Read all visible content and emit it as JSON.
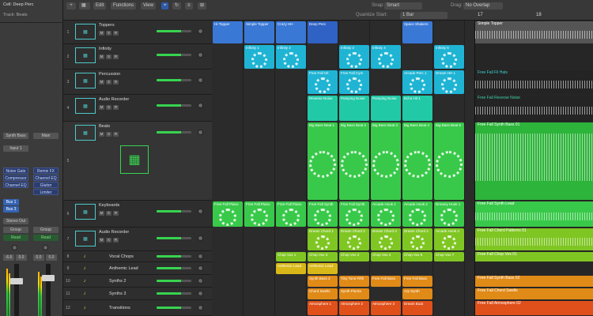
{
  "header": {
    "cell_label": "Cell: Deep Perc",
    "track_label": "Track: Beats",
    "edit_menu": "Edit",
    "functions_menu": "Functions",
    "view_menu": "View",
    "quantize_label": "Quantize Start:",
    "quantize_value": "1 Bar",
    "snap_label": "Snap:",
    "snap_value": "Smart",
    "drag_label": "Drag:",
    "drag_value": "No Overlap",
    "ruler": [
      "17",
      "18"
    ]
  },
  "inspector": {
    "strip1": {
      "setting": "Synth Bass",
      "input": "Input 1",
      "plugins": [
        "Noise Gate",
        "Compressor",
        "Channel EQ"
      ],
      "bus": "Bus 1",
      "bus2": "Bus 3",
      "output": "Stereo Out",
      "group": "Group",
      "read": "Read",
      "vol": "-6.6",
      "pan": "0.0"
    },
    "strip2": {
      "setting": "Main",
      "plugins": [
        "Remix FX",
        "Channel EQ",
        "Gluitor",
        "Limiter"
      ],
      "group": "Group",
      "read": "Read",
      "vol": "0.0",
      "pan": "0.0"
    }
  },
  "ms": {
    "m": "M",
    "s": "S",
    "r": "R"
  },
  "tracks": [
    {
      "num": "1",
      "name": "Toppers"
    },
    {
      "num": "2",
      "name": "Infinity"
    },
    {
      "num": "3",
      "name": "Percussion"
    },
    {
      "num": "4",
      "name": "Audio Recorder"
    },
    {
      "num": "5",
      "name": "Beats"
    },
    {
      "num": "6",
      "name": "Keyboards"
    },
    {
      "num": "7",
      "name": "Audio Recorder"
    },
    {
      "num": "8",
      "name": "Vocal Chops"
    },
    {
      "num": "9",
      "name": "Anthemic Lead"
    },
    {
      "num": "10",
      "name": "Synths 2"
    },
    {
      "num": "11",
      "name": "Synths 3"
    },
    {
      "num": "12",
      "name": "Transitions"
    }
  ],
  "cells": {
    "r1": [
      "Hi-Topper",
      "Simple Topper",
      "Crazy HH",
      "Deep Perc",
      "Space Shakers"
    ],
    "r2": [
      "Infinity 1",
      "Infinity 2",
      "Infinity 3",
      "Infinity 4",
      "Infinity 6"
    ],
    "r3": [
      "Free Fall Hit",
      "Free Fall Cym",
      "Arcade Perc 1",
      "Dream HH 1"
    ],
    "r4": [
      "Reverse Noise",
      "Pumping Noise",
      "Pumping Noise",
      "Echo Hit 1"
    ],
    "r5": [
      "Big Bass Beat 1",
      "Big Bass Beat 2",
      "Big Bass Beat 3",
      "Big Bass Beat 4",
      "Big Bass Beat 5"
    ],
    "r6": [
      "Free Fall Piano",
      "Free Fall Piano",
      "Free Fall Piano",
      "Free Fall Synth",
      "Free Fall Synth",
      "Arcade Hook 1",
      "Arcade Hook 2",
      "Dreamy Hook 1"
    ],
    "r7": [
      "Dream Chord 1",
      "Dream Chord 2",
      "Dream Chord 3",
      "Dream Chord 4",
      "Arcade Hook 3"
    ],
    "r8": [
      "Chop Vox 1",
      "Chop Vox 3",
      "Chop Vox 3",
      "Chop Vox 4",
      "Chop Vox 6",
      "Chop Vox 7"
    ],
    "r9": [
      "Anthemic Lead",
      "Anthemic Lead"
    ],
    "r10": [
      "Synth Bass 2",
      "Tiny Tone Fifth",
      "Free Fall Bass",
      "Free Fall Bass"
    ],
    "r11": [
      "Chord Swells",
      "Synth Plucks",
      "Arp Synth"
    ],
    "r12": [
      "Atmosphere 1",
      "Atmosphere 2",
      "Atmosphere 3",
      "Dream Boat"
    ]
  },
  "regions": [
    "Simple Topper",
    "Free Fall Fil Hats",
    "Free Fall Reverse Noise",
    "Free Fall Synth Bass 01",
    "Free Fall Synth Lead",
    "Free Fall Chord Patterns 01",
    "Free Fall Chop Vox 01",
    "Free Fall Synth Bass 02",
    "Free Fall Chord Swells",
    "Free Fall Atmosphere 02"
  ],
  "colors": {
    "blue": "#3a78d6",
    "cyan": "#1fb4d4",
    "teal": "#22c9a7",
    "green": "#39c94a",
    "lime": "#7fc623",
    "yellow": "#d8b818",
    "orange": "#e08a18",
    "red": "#e0501a"
  }
}
